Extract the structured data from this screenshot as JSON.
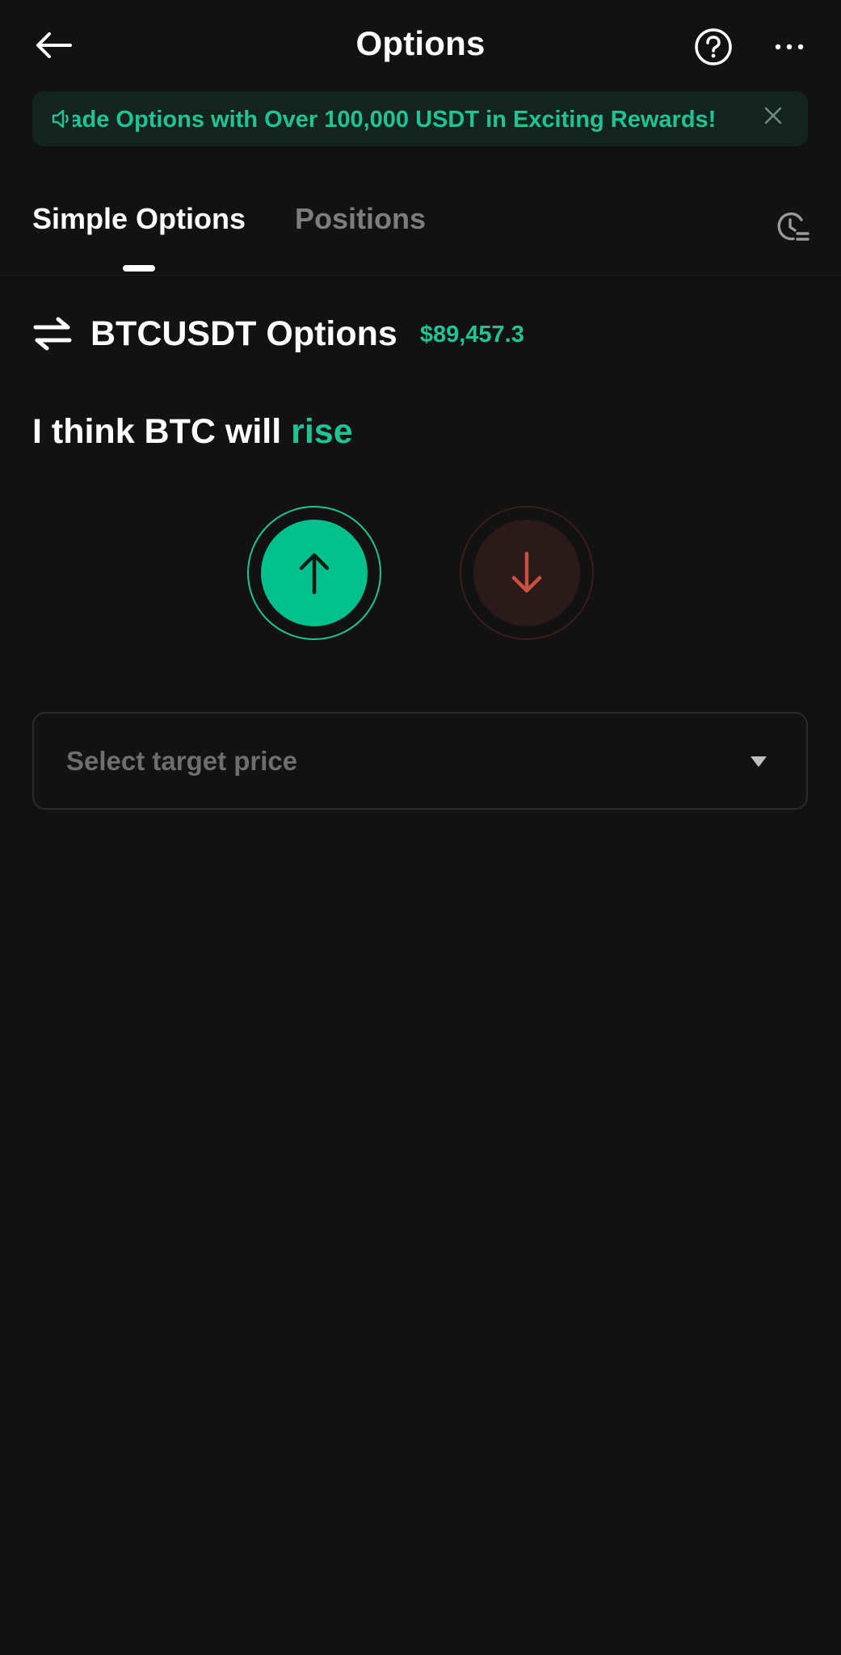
{
  "header": {
    "title": "Options"
  },
  "banner": {
    "text": "Trade Options with Over 100,000 USDT in Exciting Rewards!"
  },
  "tabs": [
    {
      "label": "Simple Options",
      "active": true
    },
    {
      "label": "Positions",
      "active": false
    }
  ],
  "pair": {
    "title": "BTCUSDT Options",
    "price": "$89,457.3"
  },
  "prediction": {
    "prefix": "I think BTC will",
    "direction": "rise"
  },
  "select": {
    "placeholder": "Select target price"
  },
  "colors": {
    "background": "#121212",
    "accent_green": "#1fc495",
    "button_green": "#00c08b",
    "down_red": "#c9523f"
  },
  "icons": {
    "back": "back-arrow-icon",
    "help": "question-circle-icon",
    "more": "more-dots-icon",
    "speaker": "speaker-icon",
    "close": "close-icon",
    "history": "clock-history-icon",
    "swap": "swap-arrows-icon",
    "up": "arrow-up-icon",
    "down": "arrow-down-icon",
    "caret": "caret-down-icon"
  }
}
